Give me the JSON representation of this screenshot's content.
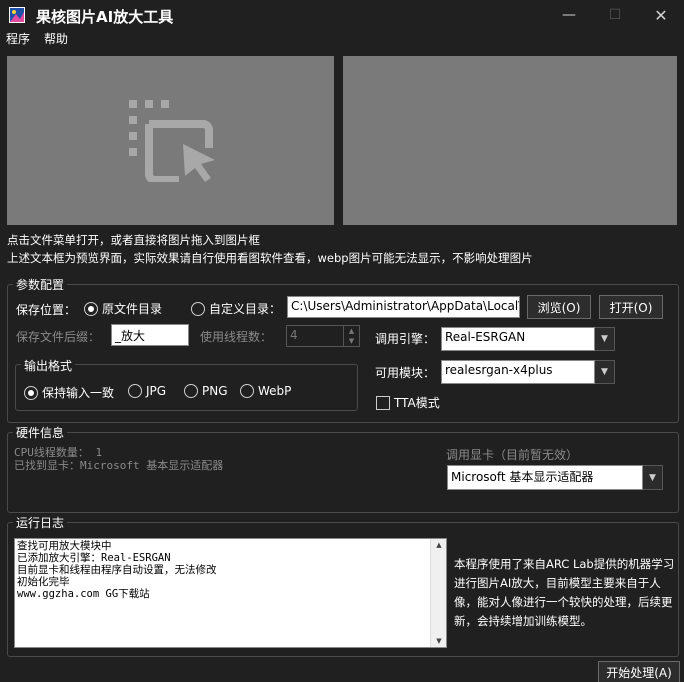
{
  "window": {
    "title": "果核图片AI放大工具",
    "icon": "app-logo-icon",
    "controls": {
      "minimize": "—",
      "maximize": "☐",
      "close": "✕"
    }
  },
  "menu": {
    "program": "程序",
    "help": "帮助"
  },
  "preview": {
    "drop_icon": "drag-drop-cursor-icon"
  },
  "hints": {
    "line1": "点击文件菜单打开，或者直接将图片拖入到图片框",
    "line2": "上述文本框为预览界面，实际效果请自行使用看图软件查看，webp图片可能无法显示，不影响处理图片"
  },
  "params": {
    "title": "参数配置",
    "save_location_label": "保存位置：",
    "radio_original_dir": "原文件目录",
    "radio_custom_dir": "自定义目录：",
    "custom_dir_value": "C:\\Users\\Administrator\\AppData\\Local\\",
    "browse_button": "浏览(O)",
    "open_button": "打开(O)",
    "suffix_label": "保存文件后缀：",
    "suffix_value": "_放大",
    "threads_label": "使用线程数：",
    "threads_value": "4",
    "engine_label": "调用引擎：",
    "engine_value": "Real-ESRGAN",
    "model_label": "可用模块：",
    "model_value": "realesrgan-x4plus",
    "tta_label": "TTA模式",
    "tta_checked": false,
    "format": {
      "title": "输出格式",
      "options": [
        "保持输入一致",
        "JPG",
        "PNG",
        "WebP"
      ],
      "selected": "保持输入一致"
    }
  },
  "hardware": {
    "title": "硬件信息",
    "cpu_line": "CPU线程数量： 1",
    "gpu_line": "已找到显卡：Microsoft 基本显示适配器",
    "gpu_select_label": "调用显卡（目前暂无效）",
    "gpu_select_value": "Microsoft 基本显示适配器"
  },
  "log": {
    "title": "运行日志",
    "lines": "查找可用放大模块中\n已添加放大引擎：Real-ESRGAN\n目前显卡和线程由程序自动设置，无法修改\n初始化完毕\nwww.ggzha.com GG下载站",
    "info": "本程序使用了来自ARC Lab提供的机器学习进行图片AI放大，目前模型主要来自于人像，能对人像进行一个较快的处理，后续更新，会持续增加训练模型。"
  },
  "start_button": "开始处理(A)",
  "colors": {
    "background": "#202020",
    "preview": "#7a7a7a",
    "text": "#ffffff",
    "dim_text": "#8a8a8a"
  }
}
